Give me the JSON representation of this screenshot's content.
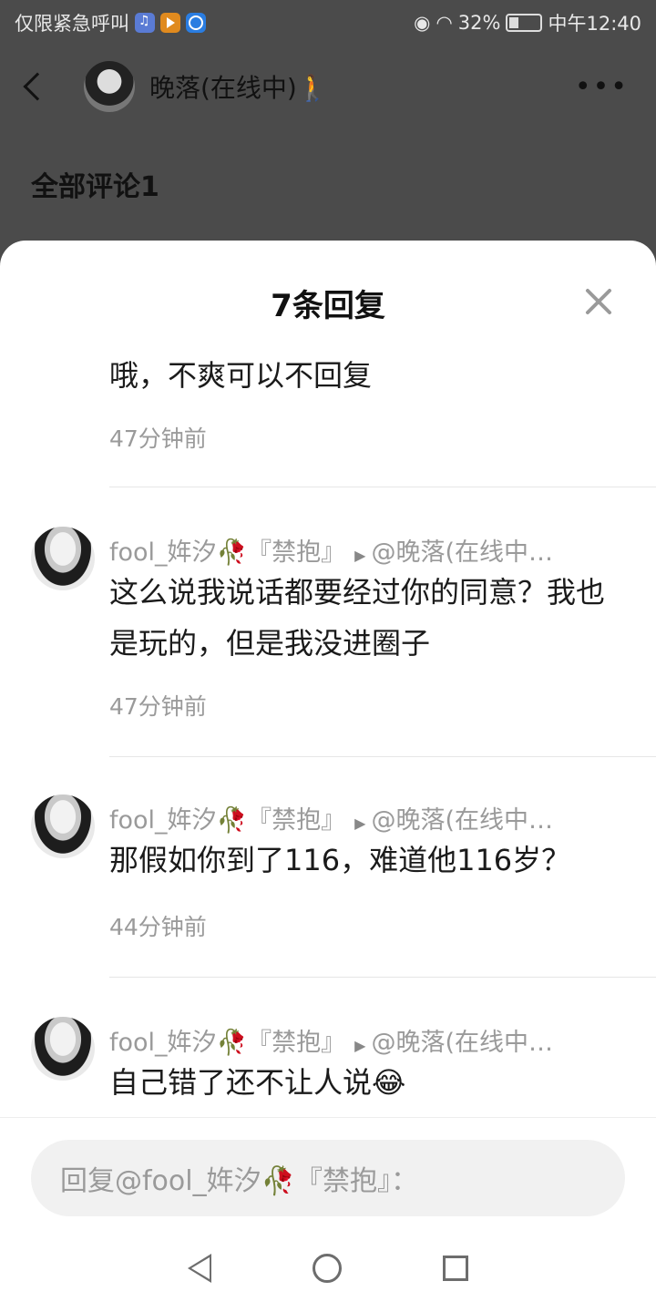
{
  "status_bar": {
    "left_text": "仅限紧急呼叫",
    "battery": "32%",
    "time": "中午12:40"
  },
  "background_page": {
    "title": "晚落(在线中)🚶",
    "section_title": "全部评论1"
  },
  "sheet": {
    "title": "7条回复",
    "replies": [
      {
        "text": "哦，不爽可以不回复",
        "time": "47分钟前"
      },
      {
        "author": "fool_姩汐",
        "author_suffix": "『禁抱』",
        "reply_to": "@晚落(在线中…",
        "text": "这么说我说话都要经过你的同意？我也是玩的，但是我没进圈子",
        "time": "47分钟前"
      },
      {
        "author": "fool_姩汐",
        "author_suffix": "『禁抱』",
        "reply_to": "@晚落(在线中…",
        "text": "那假如你到了116，难道他116岁？",
        "time": "44分钟前"
      },
      {
        "author": "fool_姩汐",
        "author_suffix": "『禁抱』",
        "reply_to": "@晚落(在线中…",
        "text": "自己错了还不让人说😂"
      }
    ],
    "reply_placeholder": "回复@fool_姩汐🥀『禁抱』："
  },
  "icons": {
    "flower": "🥀"
  }
}
